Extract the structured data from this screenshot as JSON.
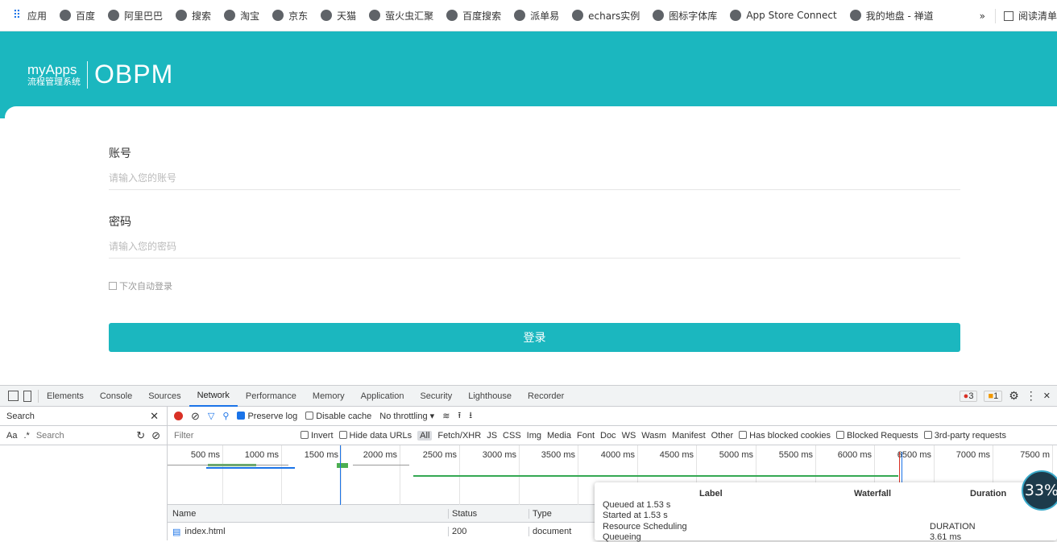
{
  "bookmarks": {
    "items": [
      {
        "label": "应用",
        "icon": "apps-grid-icon"
      },
      {
        "label": "百度",
        "icon": "baidu-icon"
      },
      {
        "label": "阿里巴巴",
        "icon": "globe-icon"
      },
      {
        "label": "搜索",
        "icon": "globe-icon"
      },
      {
        "label": "淘宝",
        "icon": "globe-icon"
      },
      {
        "label": "京东",
        "icon": "globe-icon"
      },
      {
        "label": "天猫",
        "icon": "globe-icon"
      },
      {
        "label": "萤火虫汇聚",
        "icon": "globe-icon"
      },
      {
        "label": "百度搜索",
        "icon": "globe-icon"
      },
      {
        "label": "派单易",
        "icon": "globe-icon"
      },
      {
        "label": "echars实例",
        "icon": "echarts-icon"
      },
      {
        "label": "图标字体库",
        "icon": "iconfont-icon"
      },
      {
        "label": "App Store Connect",
        "icon": "apple-icon"
      },
      {
        "label": "我的地盘 - 禅道",
        "icon": "zentao-icon"
      }
    ],
    "more": "»",
    "reading_list": "阅读清单"
  },
  "logo": {
    "brand": "myApps",
    "subtitle": "流程管理系统",
    "product": "OBPM"
  },
  "form": {
    "account_label": "账号",
    "account_placeholder": "请输入您的账号",
    "password_label": "密码",
    "password_placeholder": "请输入您的密码",
    "remember_label": "下次自动登录",
    "login_button": "登录"
  },
  "devtools": {
    "tabs": [
      "Elements",
      "Console",
      "Sources",
      "Network",
      "Performance",
      "Memory",
      "Application",
      "Security",
      "Lighthouse",
      "Recorder"
    ],
    "active_tab": "Network",
    "errors": "3",
    "warnings": "1",
    "search_title": "Search",
    "search_placeholder": "Search",
    "match_case": "Aa",
    "regex": ".*",
    "preserve_log": "Preserve log",
    "disable_cache": "Disable cache",
    "throttling": "No throttling",
    "filter_placeholder": "Filter",
    "invert": "Invert",
    "hide_data_urls": "Hide data URLs",
    "filter_types": [
      "All",
      "Fetch/XHR",
      "JS",
      "CSS",
      "Img",
      "Media",
      "Font",
      "Doc",
      "WS",
      "Wasm",
      "Manifest",
      "Other"
    ],
    "has_blocked_cookies": "Has blocked cookies",
    "blocked_requests": "Blocked Requests",
    "third_party": "3rd-party requests",
    "ticks": [
      "500 ms",
      "1000 ms",
      "1500 ms",
      "2000 ms",
      "2500 ms",
      "3000 ms",
      "3500 ms",
      "4000 ms",
      "4500 ms",
      "5000 ms",
      "5500 ms",
      "6000 ms",
      "6500 ms",
      "7000 ms",
      "7500 m"
    ],
    "table_headers": {
      "name": "Name",
      "status": "Status",
      "type": "Type"
    },
    "rows": [
      {
        "name": "index.html",
        "status": "200",
        "type": "document"
      }
    ],
    "tooltip": {
      "col_label": "Label",
      "col_waterfall": "Waterfall",
      "col_duration": "Duration",
      "queued": "Queued at 1.53 s",
      "started": "Started at 1.53 s",
      "scheduling": "Resource Scheduling",
      "queueing": "Queueing",
      "duration_label": "DURATION",
      "duration_value": "3.61 ms"
    }
  },
  "badge": "33%",
  "colors": {
    "brand": "#1bb7bf",
    "link": "#1a73e8",
    "record": "#d93025"
  }
}
